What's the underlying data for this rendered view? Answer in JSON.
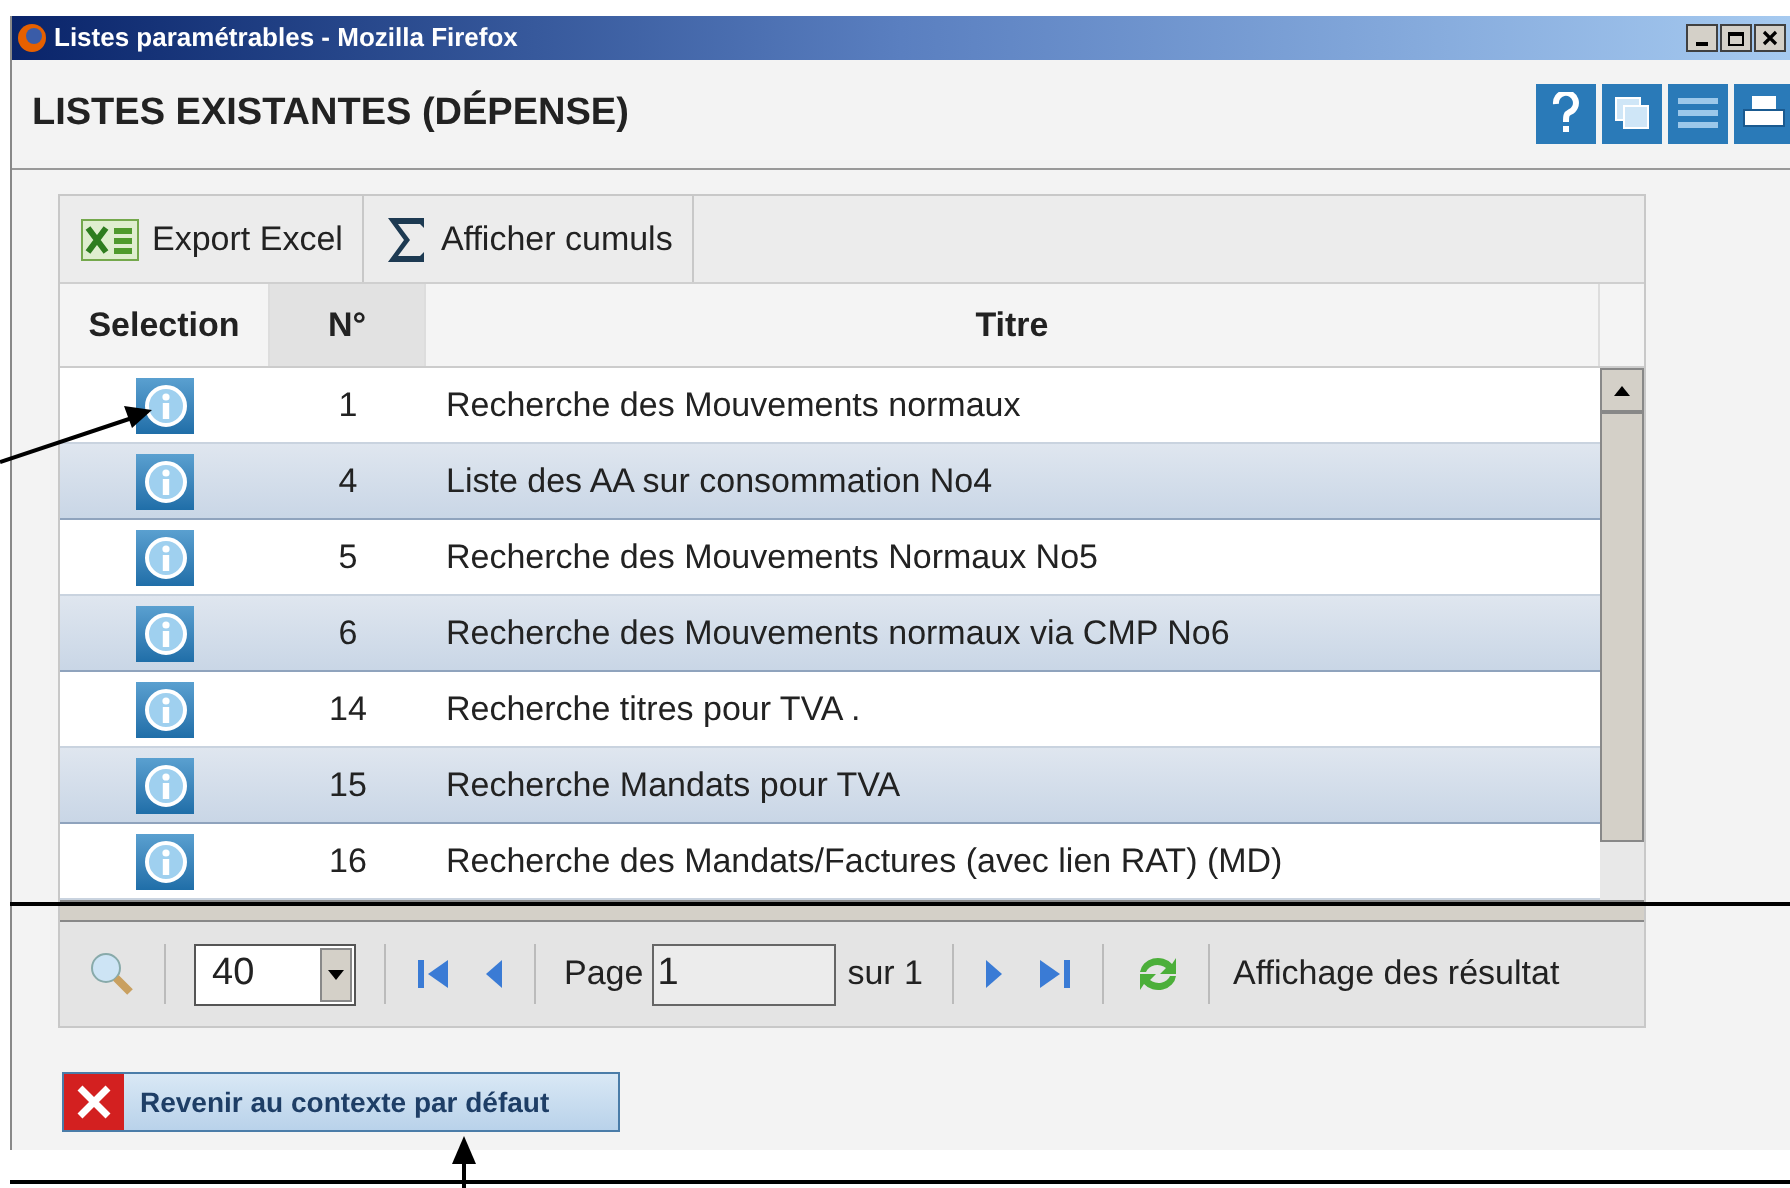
{
  "window": {
    "title": "Listes paramétrables - Mozilla Firefox"
  },
  "page": {
    "title": "LISTES EXISTANTES (DÉPENSE)"
  },
  "toolbar": [
    {
      "kind": "excel",
      "label": "Export Excel"
    },
    {
      "kind": "sum",
      "label": "Afficher cumuls"
    }
  ],
  "table": {
    "columns": [
      "Selection",
      "N°",
      "Titre"
    ],
    "rows": [
      {
        "number": "1",
        "title": "Recherche des Mouvements normaux"
      },
      {
        "number": "4",
        "title": "Liste des AA sur consommation No4"
      },
      {
        "number": "5",
        "title": "Recherche des Mouvements Normaux No5"
      },
      {
        "number": "6",
        "title": "Recherche des Mouvements normaux via CMP No6"
      },
      {
        "number": "14",
        "title": "Recherche titres pour TVA ."
      },
      {
        "number": "15",
        "title": "Recherche Mandats pour TVA"
      },
      {
        "number": "16",
        "title": "Recherche des Mandats/Factures (avec lien RAT) (MD)"
      }
    ]
  },
  "pager": {
    "page_size": "40",
    "page_label": "Page",
    "page": "1",
    "of_label": "sur 1",
    "status": "Affichage des résultat"
  },
  "reset_button": {
    "label": "Revenir au contexte par défaut"
  }
}
